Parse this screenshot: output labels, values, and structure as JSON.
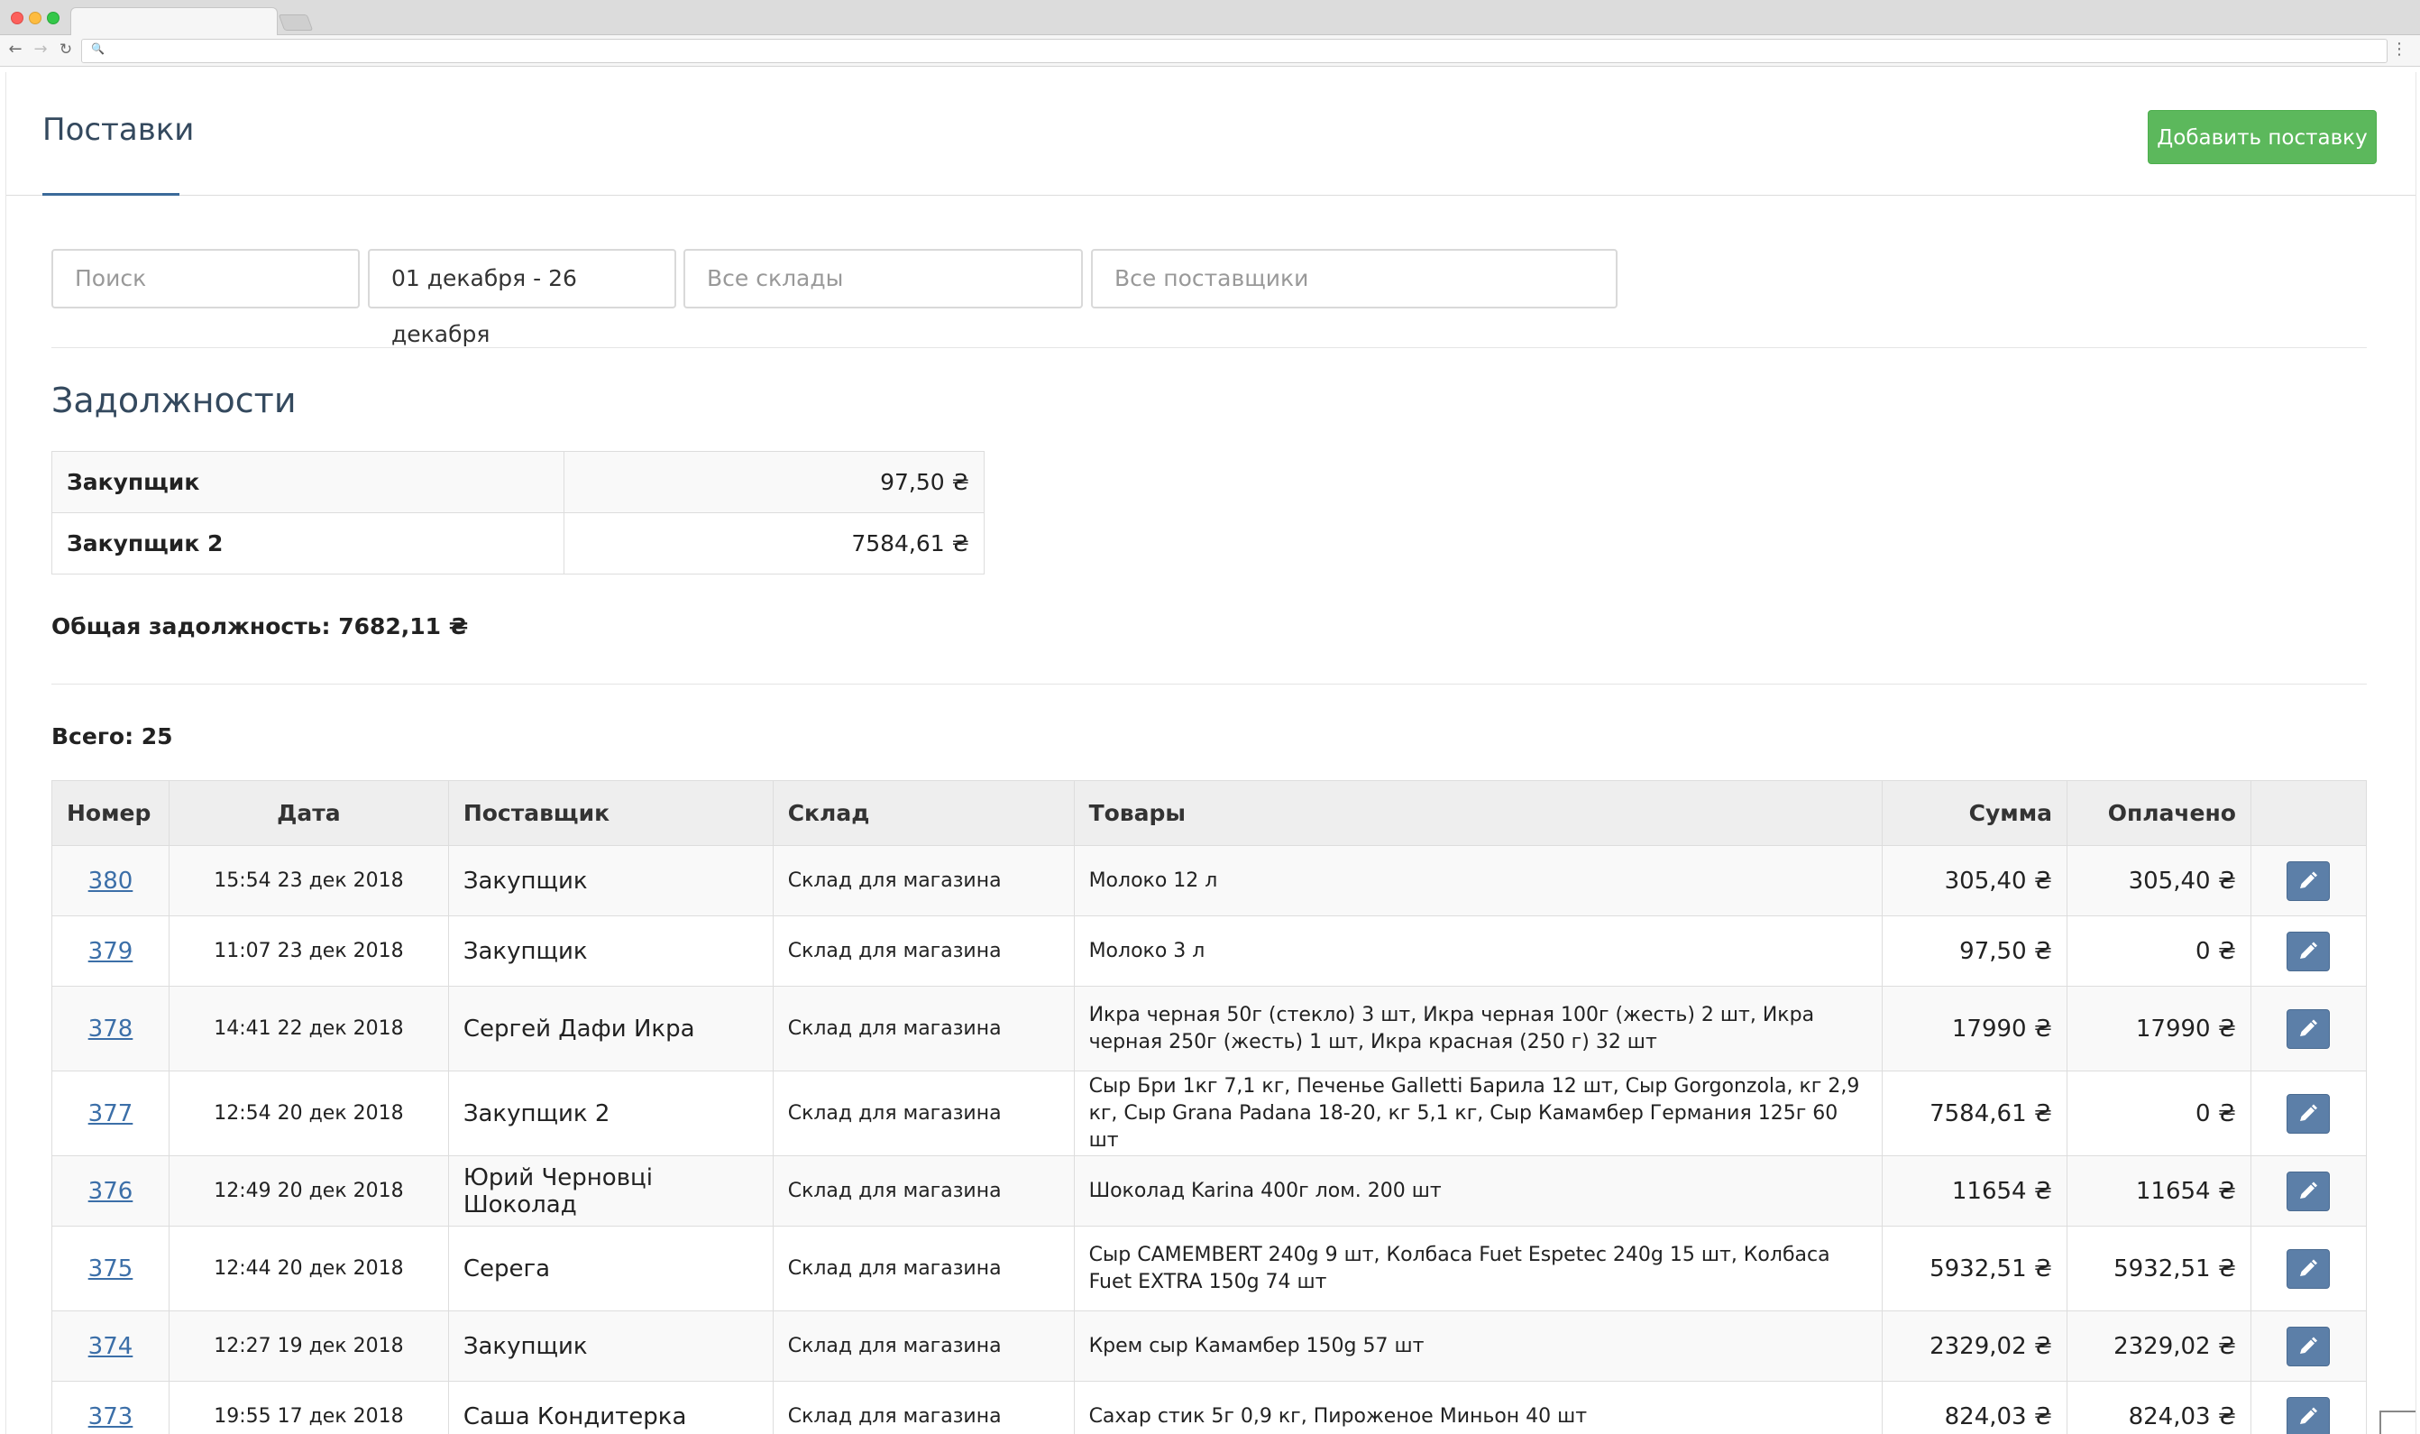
{
  "page": {
    "title": "Поставки",
    "add_button": "Добавить поставку"
  },
  "filters": {
    "search_placeholder": "Поиск",
    "date_range": "01 декабря - 26 декабря",
    "warehouse_placeholder": "Все склады",
    "supplier_placeholder": "Все поставщики"
  },
  "debts": {
    "title": "Задолжности",
    "rows": [
      {
        "name": "Закупщик",
        "amount": "97,50 ₴"
      },
      {
        "name": "Закупщик 2",
        "amount": "7584,61 ₴"
      }
    ],
    "total": "Общая задолжность: 7682,11 ₴"
  },
  "table": {
    "total_label": "Всего: 25",
    "columns": [
      "Номер",
      "Дата",
      "Поставщик",
      "Склад",
      "Товары",
      "Сумма",
      "Оплачено"
    ],
    "rows": [
      {
        "num": "380",
        "date": "15:54 23 дек 2018",
        "supplier": "Закупщик",
        "warehouse": "Склад для магазина",
        "goods": "Молоко 12 л",
        "sum": "305,40 ₴",
        "paid": "305,40 ₴",
        "paid_status": "ok"
      },
      {
        "num": "379",
        "date": "11:07 23 дек 2018",
        "supplier": "Закупщик",
        "warehouse": "Склад для магазина",
        "goods": "Молоко 3 л",
        "sum": "97,50 ₴",
        "paid": "0 ₴",
        "paid_status": "no"
      },
      {
        "num": "378",
        "date": "14:41 22 дек 2018",
        "supplier": "Сергей Дафи Икра",
        "warehouse": "Склад для магазина",
        "goods": "Икра черная 50г (стекло) 3 шт, Икра черная 100г (жесть) 2 шт, Икра черная 250г (жесть) 1 шт, Икра красная (250 г) 32 шт",
        "sum": "17990 ₴",
        "paid": "17990 ₴",
        "paid_status": "ok"
      },
      {
        "num": "377",
        "date": "12:54 20 дек 2018",
        "supplier": "Закупщик 2",
        "warehouse": "Склад для магазина",
        "goods": "Сыр Бри 1кг 7,1 кг, Печенье Galletti Барила 12 шт, Сыр Gorgonzola, кг 2,9 кг, Сыр Grana Padana 18-20, кг 5,1 кг, Сыр Камамбер Германия 125г 60 шт",
        "sum": "7584,61 ₴",
        "paid": "0 ₴",
        "paid_status": "no"
      },
      {
        "num": "376",
        "date": "12:49 20 дек 2018",
        "supplier": "Юрий Черновці Шоколад",
        "warehouse": "Склад для магазина",
        "goods": "Шоколад Karina 400г лом. 200 шт",
        "sum": "11654 ₴",
        "paid": "11654 ₴",
        "paid_status": "ok"
      },
      {
        "num": "375",
        "date": "12:44 20 дек 2018",
        "supplier": "Серега",
        "warehouse": "Склад для магазина",
        "goods": "Сыр CAMEMBERT 240g 9 шт, Колбаса Fuet Espetec 240g 15 шт, Колбаса Fuet EXTRA 150g 74 шт",
        "sum": "5932,51 ₴",
        "paid": "5932,51 ₴",
        "paid_status": "ok"
      },
      {
        "num": "374",
        "date": "12:27 19 дек 2018",
        "supplier": "Закупщик",
        "warehouse": "Склад для магазина",
        "goods": "Крем сыр Камамбер 150g 57 шт",
        "sum": "2329,02 ₴",
        "paid": "2329,02 ₴",
        "paid_status": "ok"
      },
      {
        "num": "373",
        "date": "19:55 17 дек 2018",
        "supplier": "Саша Кондитерка",
        "warehouse": "Склад для магазина",
        "goods": "Сахар стик 5г 0,9 кг, Пироженое Миньон 40 шт",
        "sum": "824,03 ₴",
        "paid": "824,03 ₴",
        "paid_status": "ok"
      }
    ]
  },
  "colors": {
    "accent": "#5cb85c",
    "link": "#3c6fa8",
    "paid_ok": "#2f8a1c",
    "paid_no": "#e01818",
    "edit_button": "#5c7fa8"
  },
  "icons": {
    "edit": "pencil-icon"
  }
}
